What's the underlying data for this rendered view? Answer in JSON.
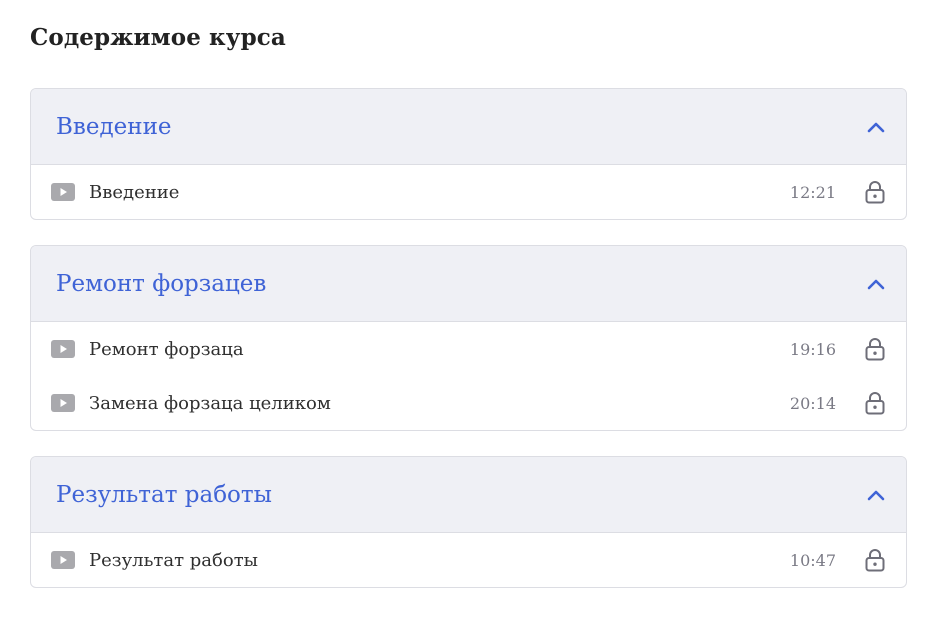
{
  "page": {
    "title": "Содержимое курса"
  },
  "colors": {
    "accent": "#3f63d6",
    "header_bg": "#eff0f5",
    "border": "#dcdde3",
    "icon_gray": "#a9a9ad"
  },
  "sections": [
    {
      "title": "Введение",
      "expanded_icon": "chevron-up-icon",
      "lessons": [
        {
          "title": "Введение",
          "duration": "12:21",
          "icon": "play-icon",
          "status_icon": "lock-icon"
        }
      ]
    },
    {
      "title": "Ремонт форзацев",
      "expanded_icon": "chevron-up-icon",
      "lessons": [
        {
          "title": "Ремонт форзаца",
          "duration": "19:16",
          "icon": "play-icon",
          "status_icon": "lock-icon"
        },
        {
          "title": "Замена форзаца целиком",
          "duration": "20:14",
          "icon": "play-icon",
          "status_icon": "lock-icon"
        }
      ]
    },
    {
      "title": "Результат работы",
      "expanded_icon": "chevron-up-icon",
      "lessons": [
        {
          "title": "Результат работы",
          "duration": "10:47",
          "icon": "play-icon",
          "status_icon": "lock-icon"
        }
      ]
    }
  ]
}
